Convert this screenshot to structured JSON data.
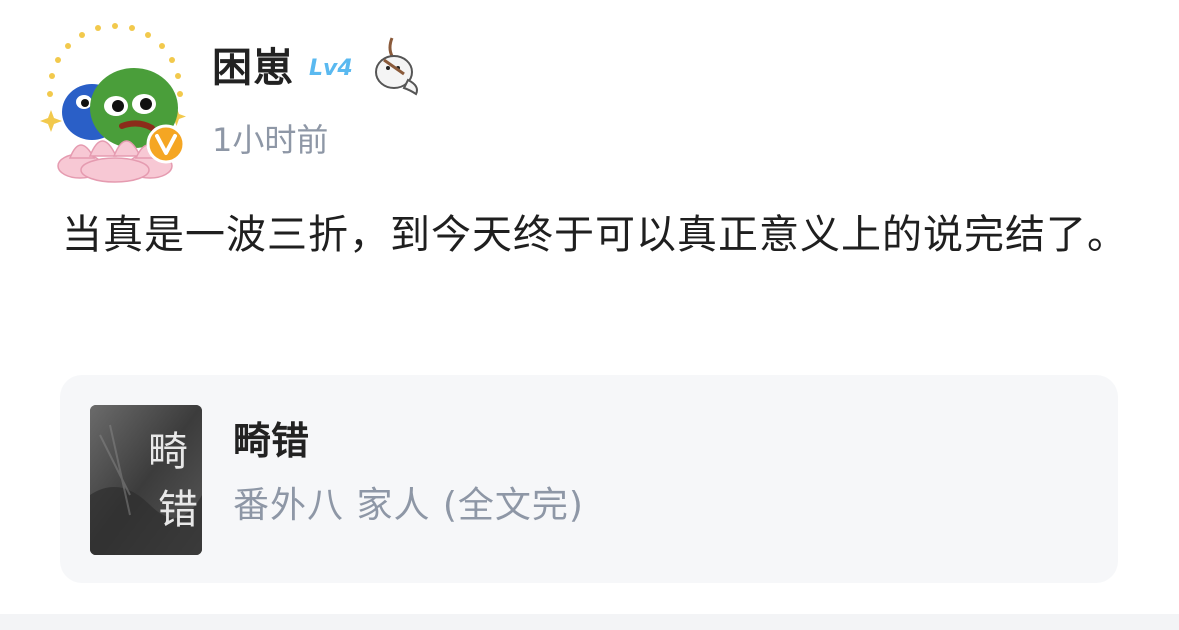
{
  "post": {
    "author": {
      "name": "困崽",
      "level": "Lv4",
      "verified_icon": "verified-v-icon",
      "avatar": "frog-avatar-icon",
      "pendant": "seal-pendant-icon"
    },
    "timestamp": "1小时前",
    "content": "当真是一波三折，到今天终于可以真正意义上的说完结了。",
    "book": {
      "title": "畸错",
      "subtitle": "番外八 家人 (全文完)",
      "cover_text": "畸错"
    }
  },
  "colors": {
    "level_badge": "#5ab9f0",
    "verified": "#f5a623",
    "muted_text": "#8e97a6",
    "card_bg": "#f6f7f9"
  }
}
